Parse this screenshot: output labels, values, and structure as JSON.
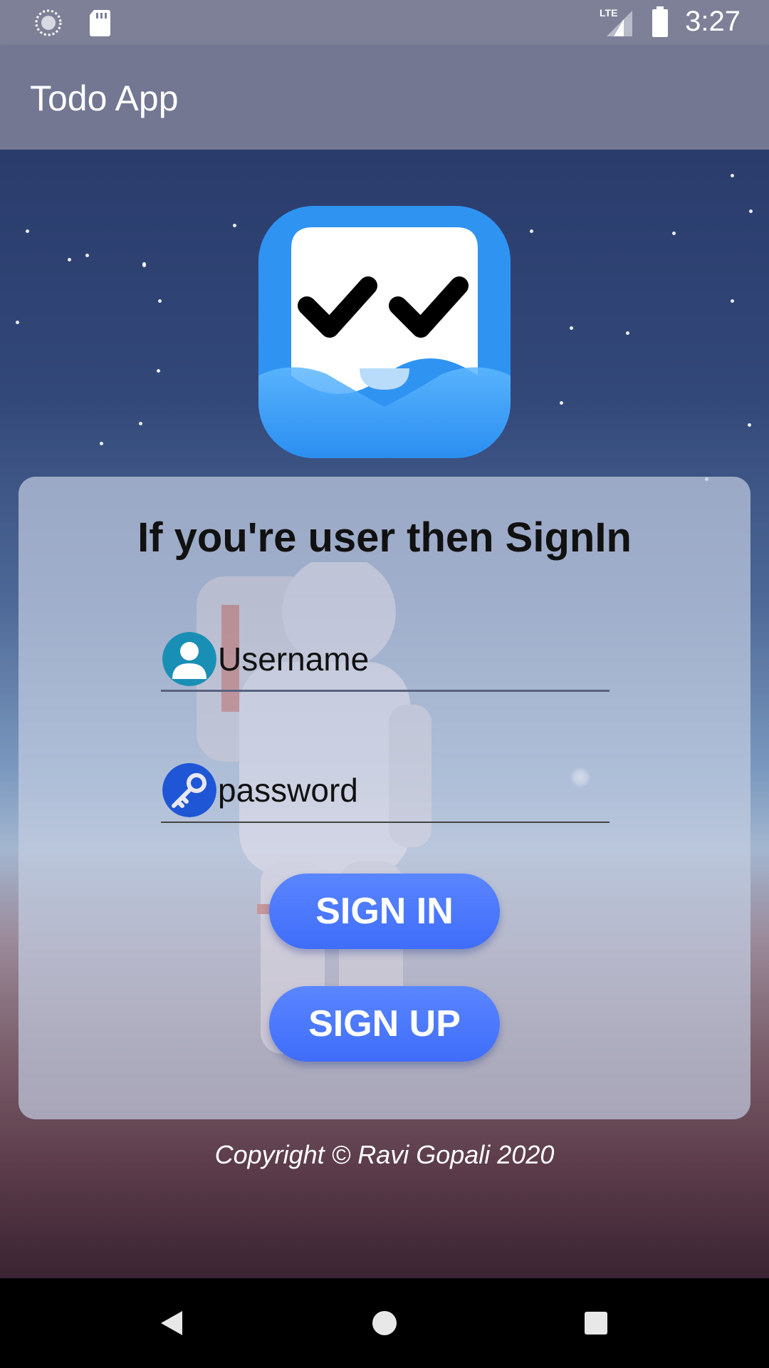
{
  "status_bar": {
    "time": "3:27",
    "network": "LTE",
    "icons": [
      "sync-icon",
      "sd-card-icon",
      "signal-icon",
      "battery-icon"
    ]
  },
  "app_bar": {
    "title": "Todo App"
  },
  "logo": {
    "icon": "todo-app-logo-icon",
    "color": "#2f93f2"
  },
  "signin_card": {
    "title": "If you're user then SignIn",
    "username": {
      "placeholder": "Username",
      "value": "",
      "icon": "user-icon"
    },
    "password": {
      "placeholder": "password",
      "value": "",
      "icon": "key-icon"
    },
    "signin_button": "SIGN IN",
    "signup_button": "SIGN UP",
    "button_color": "#4d7bfd"
  },
  "footer": {
    "copyright": "Copyright © Ravi Gopali 2020"
  },
  "nav_bar": {
    "icons": [
      "back-icon",
      "home-icon",
      "recents-icon"
    ]
  }
}
